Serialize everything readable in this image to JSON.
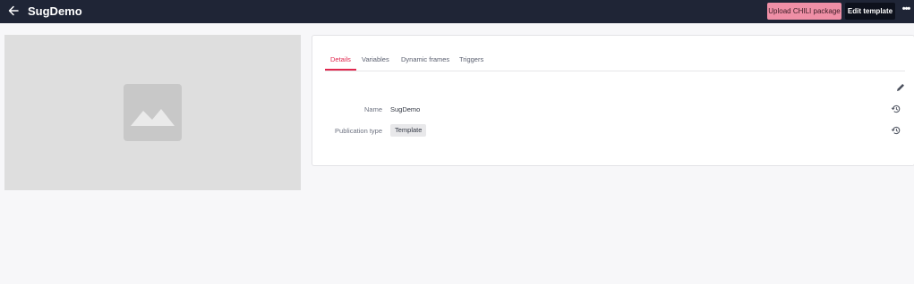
{
  "header": {
    "title": "SugDemo",
    "upload_label": "Upload CHILI package",
    "edit_label": "Edit template",
    "more_label": "•••"
  },
  "details": {
    "tabs": [
      {
        "label": "Details",
        "active": true
      },
      {
        "label": "Variables",
        "active": false
      },
      {
        "label": "Dynamic frames",
        "active": false
      },
      {
        "label": "Triggers",
        "active": false
      }
    ],
    "name_label": "Name",
    "name_value": "SugDemo",
    "publication_type_label": "Publication type",
    "publication_type_value": "Template"
  },
  "icons": {
    "back": "arrow-left-icon",
    "edit": "pencil-icon",
    "history": "history-icon",
    "preview": "image-placeholder-icon"
  },
  "colors": {
    "topbar": "#1f2536",
    "accent": "#e0284f",
    "upload_button": "#ef8fa6",
    "edit_button": "#0d111c"
  }
}
